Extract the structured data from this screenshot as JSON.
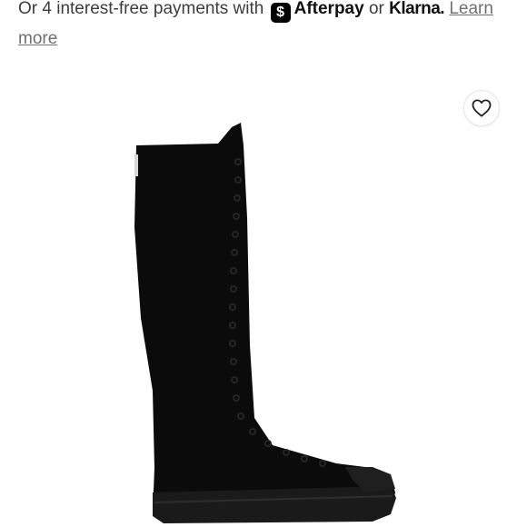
{
  "payment": {
    "prefix": "Or 4 interest-free payments with",
    "afterpay_logo_glyph": "$",
    "afterpay_label": "Afterpay",
    "or_text": "or",
    "klarna_label": "Klarna.",
    "learn_more": "Learn more"
  },
  "favorite": {
    "icon": "heart-icon"
  },
  "product": {
    "image": "black knee-high lace-up canvas sneaker boot",
    "color": "#0b0b0b"
  }
}
